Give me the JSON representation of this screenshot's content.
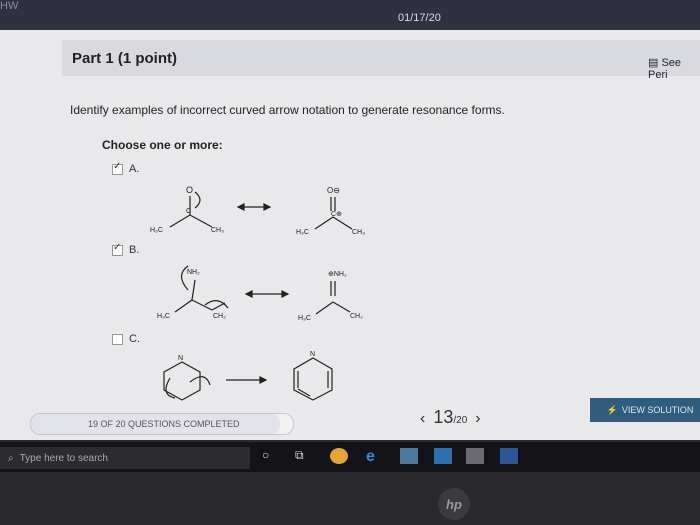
{
  "system": {
    "tab_label": "HW",
    "date": "01/17/20"
  },
  "header": {
    "part_title": "Part 1  (1 point)",
    "see_periodic": "See Peri"
  },
  "question": {
    "text": "Identify examples of incorrect curved arrow notation to generate resonance forms.",
    "choose_label": "Choose one or more:"
  },
  "options": [
    {
      "letter": "A.",
      "checked": true
    },
    {
      "letter": "B.",
      "checked": true
    },
    {
      "letter": "C.",
      "checked": false
    }
  ],
  "labels": {
    "h3c": "H₃C",
    "ch3": "CH₃",
    "ch2": "CH₂",
    "nh2": "NH₂",
    "o": "O",
    "c": "C",
    "n": "N",
    "o_minus": "O⊖",
    "c_plus": "C⊕",
    "n_plus": "⊕NH₂"
  },
  "footer": {
    "progress_text": "19 OF 20 QUESTIONS COMPLETED",
    "progress_fraction": 0.95,
    "page_current": "13",
    "page_total": "/20",
    "view_solution": "VIEW SOLUTION"
  },
  "taskbar": {
    "search_placeholder": "Type here to search"
  },
  "colors": {
    "accent": "#2f5d7e",
    "topbar": "#2f3140"
  },
  "icons": {
    "cortana": "ring-icon",
    "task_view": "task-view-icon",
    "chrome": "chrome-icon",
    "edge": "edge-icon",
    "explorer": "folder-icon",
    "outlook": "outlook-icon",
    "word": "word-icon",
    "search": "search-icon",
    "hp": "hp-logo"
  }
}
